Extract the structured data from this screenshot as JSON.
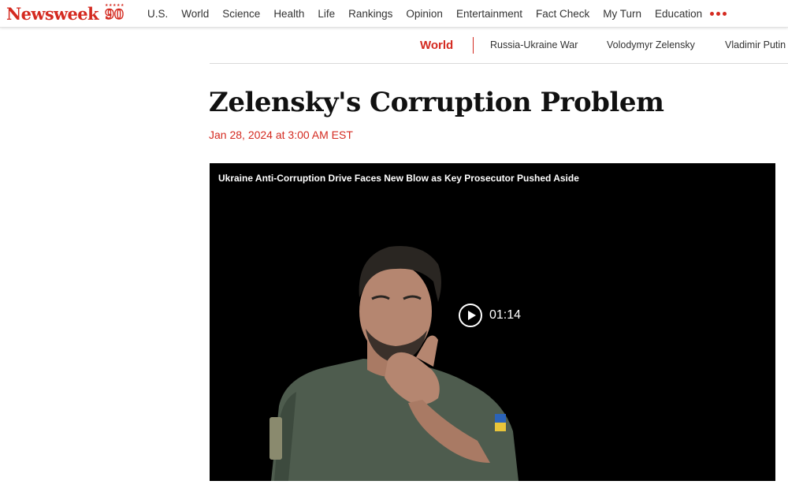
{
  "site": {
    "name": "Newsweek",
    "anniversary": "90",
    "brand_color": "#d42a20"
  },
  "nav": {
    "items": [
      "U.S.",
      "World",
      "Science",
      "Health",
      "Life",
      "Rankings",
      "Opinion",
      "Entertainment",
      "Fact Check",
      "My Turn",
      "Education"
    ],
    "more_icon": "ellipsis-icon"
  },
  "subnav": {
    "section": "World",
    "links": [
      "Russia-Ukraine War",
      "Volodymyr Zelensky",
      "Vladimir Putin"
    ]
  },
  "article": {
    "headline": "Zelensky's Corruption Problem",
    "date": "Jan 28, 2024 at 3:00 AM EST"
  },
  "video": {
    "title": "Ukraine Anti-Corruption Drive Faces New Blow as Key Prosecutor Pushed Aside",
    "duration": "01:14",
    "play_icon": "play-icon"
  }
}
